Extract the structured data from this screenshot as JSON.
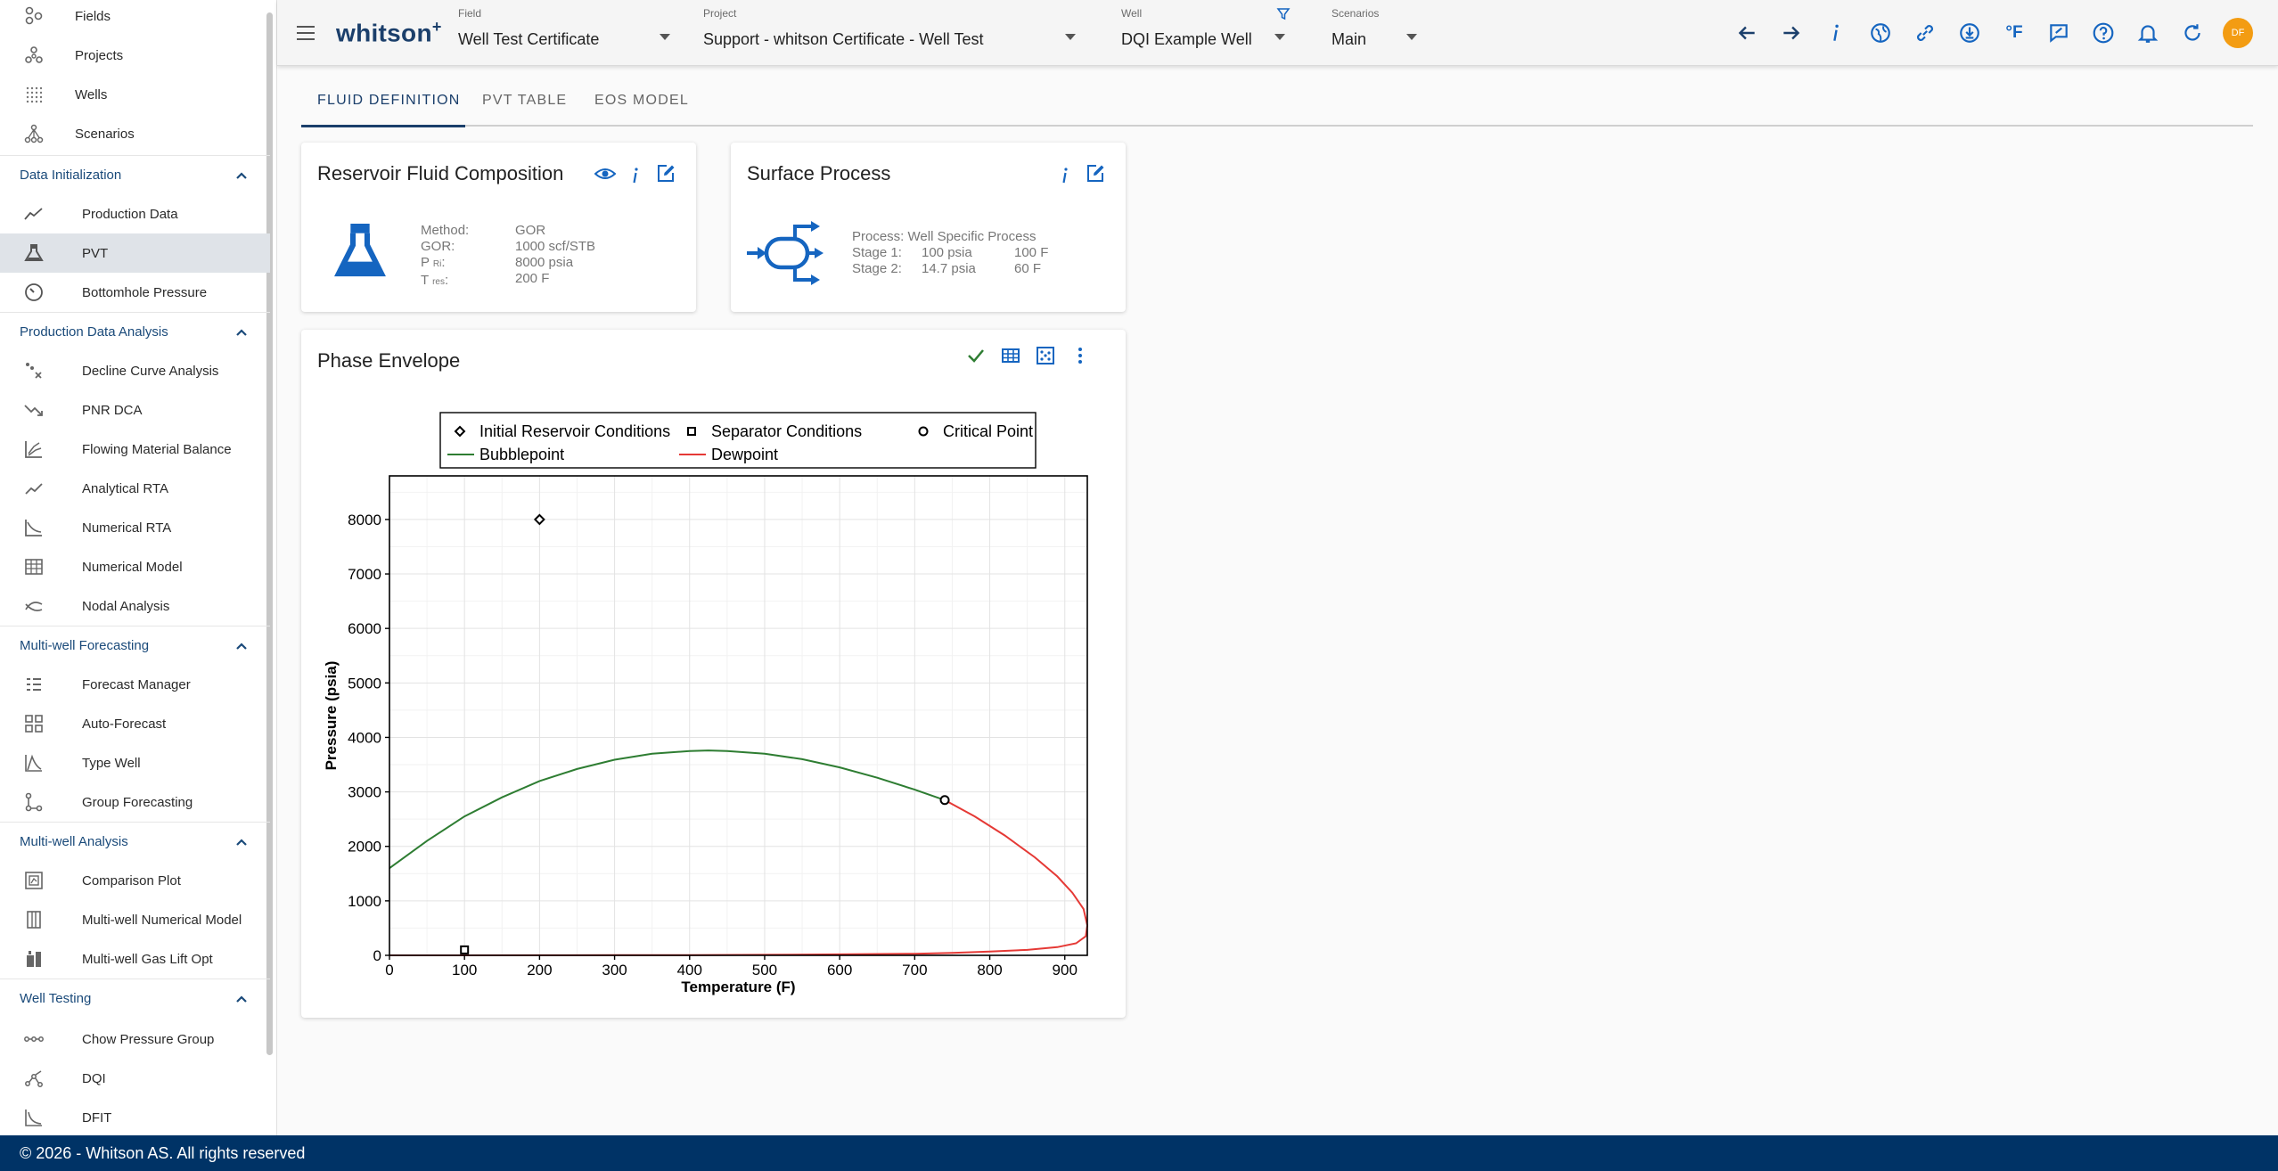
{
  "sidebar": {
    "top_items": [
      {
        "label": "Fields",
        "icon": "fields-icon"
      },
      {
        "label": "Projects",
        "icon": "projects-icon"
      },
      {
        "label": "Wells",
        "icon": "wells-icon"
      },
      {
        "label": "Scenarios",
        "icon": "scenarios-icon"
      }
    ],
    "sections": [
      {
        "title": "Data Initialization",
        "items": [
          {
            "label": "Production Data",
            "icon": "production-data-icon"
          },
          {
            "label": "PVT",
            "icon": "flask-icon",
            "active": true
          },
          {
            "label": "Bottomhole Pressure",
            "icon": "gauge-icon"
          }
        ]
      },
      {
        "title": "Production Data Analysis",
        "items": [
          {
            "label": "Decline Curve Analysis",
            "icon": "decline-curve-icon"
          },
          {
            "label": "PNR DCA",
            "icon": "trend-down-icon"
          },
          {
            "label": "Flowing Material Balance",
            "icon": "chart-lines-icon"
          },
          {
            "label": "Analytical RTA",
            "icon": "chart-line-icon"
          },
          {
            "label": "Numerical RTA",
            "icon": "numerical-rta-icon"
          },
          {
            "label": "Numerical Model",
            "icon": "grid-model-icon"
          },
          {
            "label": "Nodal Analysis",
            "icon": "nodal-icon"
          }
        ]
      },
      {
        "title": "Multi-well Forecasting",
        "items": [
          {
            "label": "Forecast Manager",
            "icon": "list-icon"
          },
          {
            "label": "Auto-Forecast",
            "icon": "grid-icon"
          },
          {
            "label": "Type Well",
            "icon": "type-well-icon"
          },
          {
            "label": "Group Forecasting",
            "icon": "group-icon"
          }
        ]
      },
      {
        "title": "Multi-well Analysis",
        "items": [
          {
            "label": "Comparison Plot",
            "icon": "comparison-icon"
          },
          {
            "label": "Multi-well Numerical Model",
            "icon": "columns-icon"
          },
          {
            "label": "Multi-well Gas Lift Opt",
            "icon": "gas-lift-icon"
          }
        ]
      },
      {
        "title": "Well Testing",
        "items": [
          {
            "label": "Chow Pressure Group",
            "icon": "chow-icon"
          },
          {
            "label": "DQI",
            "icon": "dqi-icon"
          },
          {
            "label": "DFIT",
            "icon": "dfit-icon"
          }
        ]
      }
    ]
  },
  "topbar": {
    "brand": "whitson",
    "brand_sup": "+",
    "field": {
      "caption": "Field",
      "value": "Well Test Certificate"
    },
    "project": {
      "caption": "Project",
      "value": "Support - whitson Certificate - Well Test"
    },
    "well": {
      "caption": "Well",
      "value": "DQI Example Well"
    },
    "scenario": {
      "caption": "Scenarios",
      "value": "Main"
    },
    "temp_unit": "°F",
    "avatar_initials": "DF"
  },
  "tabs": [
    "FLUID DEFINITION",
    "PVT TABLE",
    "EOS MODEL"
  ],
  "reservoir_card": {
    "title": "Reservoir Fluid Composition",
    "rows": [
      {
        "key": "Method:",
        "value": "GOR"
      },
      {
        "key": "GOR:",
        "value": "1000 scf/STB"
      },
      {
        "key": "P",
        "sub": "Ri",
        "value": "8000 psia"
      },
      {
        "key": "T",
        "sub": "res",
        "value": "200 F"
      }
    ]
  },
  "surface_card": {
    "title": "Surface Process",
    "process": "Process: Well Specific Process",
    "stages": [
      {
        "label": "Stage 1:",
        "pressure": "100 psia",
        "temp": "100 F"
      },
      {
        "label": "Stage 2:",
        "pressure": "14.7 psia",
        "temp": "60 F"
      }
    ]
  },
  "phase_card": {
    "title": "Phase Envelope"
  },
  "colors": {
    "primary": "#1b3f6b",
    "accent": "#1565c0",
    "bubble": "#2e7d32",
    "dew": "#e53935",
    "footer": "#003366"
  },
  "chart_data": {
    "type": "line",
    "xlabel": "Temperature (F)",
    "ylabel": "Pressure (psia)",
    "xlim": [
      0,
      930
    ],
    "ylim": [
      0,
      8800
    ],
    "xticks": [
      0,
      100,
      200,
      300,
      400,
      500,
      600,
      700,
      800,
      900
    ],
    "yticks": [
      0,
      1000,
      2000,
      3000,
      4000,
      5000,
      6000,
      7000,
      8000
    ],
    "grid": true,
    "legend": {
      "placement": "top",
      "entries": [
        "Initial Reservoir Conditions",
        "Separator Conditions",
        "Critical Point",
        "Bubblepoint",
        "Dewpoint"
      ]
    },
    "series": [
      {
        "name": "Bubblepoint",
        "x": [
          0,
          50,
          100,
          150,
          200,
          250,
          300,
          350,
          400,
          425,
          450,
          500,
          550,
          600,
          650,
          700,
          740
        ],
        "y": [
          1600,
          2100,
          2550,
          2900,
          3200,
          3420,
          3590,
          3700,
          3750,
          3760,
          3750,
          3700,
          3600,
          3450,
          3260,
          3040,
          2850
        ]
      },
      {
        "name": "Dewpoint",
        "x": [
          740,
          780,
          820,
          860,
          890,
          910,
          925,
          930,
          928,
          915,
          890,
          850,
          800,
          750,
          700,
          600,
          500,
          400,
          300,
          200,
          100,
          0
        ],
        "y": [
          2850,
          2550,
          2200,
          1800,
          1450,
          1150,
          850,
          550,
          350,
          220,
          150,
          100,
          70,
          45,
          30,
          18,
          10,
          5,
          3,
          1,
          0,
          0
        ]
      }
    ],
    "points": [
      {
        "name": "Initial Reservoir Conditions",
        "x": 200,
        "y": 8000,
        "marker": "diamond"
      },
      {
        "name": "Separator Conditions",
        "x": 100,
        "y": 100,
        "marker": "square"
      },
      {
        "name": "Critical Point",
        "x": 740,
        "y": 2850,
        "marker": "circle"
      }
    ]
  },
  "footer": "© 2026 - Whitson AS. All rights reserved"
}
